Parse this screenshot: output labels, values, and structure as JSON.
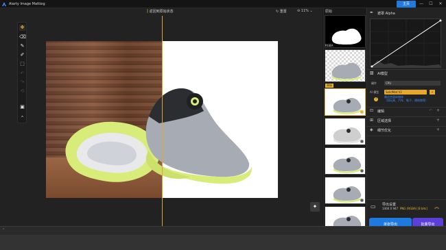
{
  "app": {
    "title": "Aiarty Image Matting",
    "home_label": "主页"
  },
  "window_controls": [
    "—",
    "☐",
    "✕"
  ],
  "toolbar": {
    "back_to_original": "返回到原始状态",
    "reset_label": "重置",
    "zoom_level": "11%"
  },
  "tools": [
    {
      "name": "move-icon",
      "glyph": "✥",
      "state": "active"
    },
    {
      "name": "eraser-icon",
      "glyph": "⌫",
      "state": "normal"
    },
    {
      "name": "brush-icon",
      "glyph": "✎",
      "state": "normal"
    },
    {
      "name": "paint-brush-icon",
      "glyph": "✐",
      "state": "normal"
    },
    {
      "name": "fill-icon",
      "glyph": "⬚",
      "state": "normal"
    },
    {
      "name": "undo-icon",
      "glyph": "↶",
      "state": "dim"
    },
    {
      "name": "redo-icon",
      "glyph": "↷",
      "state": "dim"
    },
    {
      "name": "history-icon",
      "glyph": "⟲",
      "state": "dim"
    },
    {
      "name": "compare-icon",
      "glyph": "▣",
      "state": "normal"
    },
    {
      "name": "collapse-tools-icon",
      "glyph": "⌃",
      "state": "normal"
    }
  ],
  "thumbnails": {
    "header": "原始",
    "rgba_label": "RGBA",
    "original_tag": "原始",
    "items_count_label": ""
  },
  "panel": {
    "alpha_title": "遮罩 Alpha",
    "ai_title": "AI模型",
    "engine_label": "硬件",
    "engine_value": "CPU",
    "model_label": "AI 模型",
    "model_value": "SolidMat V2",
    "model_note_line1": "最适合固体物体",
    "model_note_line2": "（如玩具、汽车、鞋子、建筑物等）",
    "edit_title": "编辑",
    "region_title": "区域选择",
    "detail_title": "细节优化",
    "export_title": "导出设置",
    "export_size": "1400 X 947",
    "export_format": "PNG (RGBA) [8 bits]",
    "single_export": "单张导出",
    "batch_export": "批量导出"
  },
  "colors": {
    "accent": "#e8b533",
    "blue": "#1f7ae0",
    "purple": "#5b3fd8"
  }
}
